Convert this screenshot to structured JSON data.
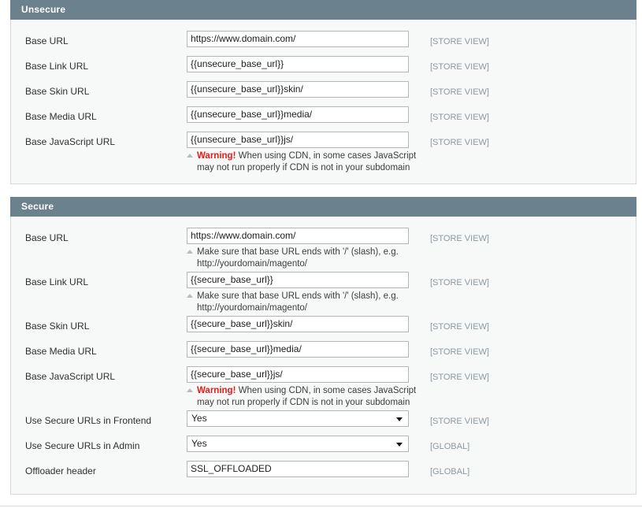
{
  "panels": [
    {
      "title": "Unsecure",
      "rows": [
        {
          "label": "Base URL",
          "type": "text",
          "value": "https://www.domain.com/",
          "scope": "[STORE VIEW]"
        },
        {
          "label": "Base Link URL",
          "type": "text",
          "value": "{{unsecure_base_url}}",
          "scope": "[STORE VIEW]"
        },
        {
          "label": "Base Skin URL",
          "type": "text",
          "value": "{{unsecure_base_url}}skin/",
          "scope": "[STORE VIEW]"
        },
        {
          "label": "Base Media URL",
          "type": "text",
          "value": "{{unsecure_base_url}}media/",
          "scope": "[STORE VIEW]"
        },
        {
          "label": "Base JavaScript URL",
          "type": "text",
          "value": "{{unsecure_base_url}}js/",
          "scope": "[STORE VIEW]",
          "note": {
            "kind": "warning",
            "prefix": "Warning!",
            "line1": " When using CDN, in some cases JavaScript",
            "line2": "may not run properly if CDN is not in your subdomain"
          }
        }
      ]
    },
    {
      "title": "Secure",
      "rows": [
        {
          "label": "Base URL",
          "type": "text",
          "value": "https://www.domain.com/",
          "scope": "[STORE VIEW]",
          "note": {
            "kind": "hint",
            "prefix": "",
            "line1": "Make sure that base URL ends with '/' (slash), e.g.",
            "line2": "http://yourdomain/magento/"
          }
        },
        {
          "label": "Base Link URL",
          "type": "text",
          "value": "{{secure_base_url}}",
          "scope": "[STORE VIEW]",
          "note": {
            "kind": "hint",
            "prefix": "",
            "line1": "Make sure that base URL ends with '/' (slash), e.g.",
            "line2": "http://yourdomain/magento/"
          }
        },
        {
          "label": "Base Skin URL",
          "type": "text",
          "value": "{{secure_base_url}}skin/",
          "scope": "[STORE VIEW]"
        },
        {
          "label": "Base Media URL",
          "type": "text",
          "value": "{{secure_base_url}}media/",
          "scope": "[STORE VIEW]"
        },
        {
          "label": "Base JavaScript URL",
          "type": "text",
          "value": "{{secure_base_url}}js/",
          "scope": "[STORE VIEW]",
          "note": {
            "kind": "warning",
            "prefix": "Warning!",
            "line1": " When using CDN, in some cases JavaScript",
            "line2": "may not run properly if CDN is not in your subdomain"
          }
        },
        {
          "label": "Use Secure URLs in Frontend",
          "type": "select",
          "value": "Yes",
          "scope": "[STORE VIEW]"
        },
        {
          "label": "Use Secure URLs in Admin",
          "type": "select",
          "value": "Yes",
          "scope": "[GLOBAL]"
        },
        {
          "label": "Offloader header",
          "type": "text",
          "value": "SSL_OFFLOADED",
          "scope": "[GLOBAL]"
        }
      ]
    }
  ],
  "colors": {
    "header_bg": "#6c818e",
    "panel_bg": "#f7f8f8",
    "scope_text": "#8b9aa3",
    "warning_text": "#e41b1b",
    "field_border": "#b3b6b8"
  }
}
